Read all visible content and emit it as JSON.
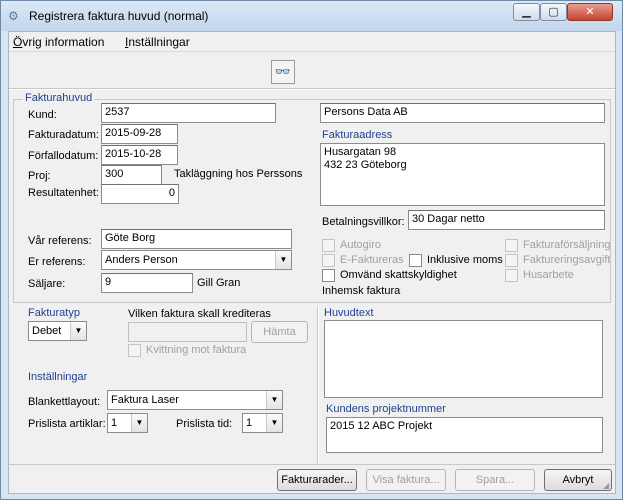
{
  "window": {
    "title": "Registrera faktura huvud (normal)"
  },
  "menu": {
    "item1_first": "Ö",
    "item1_rest": "vrig information",
    "item2_first": "I",
    "item2_rest": "nställningar"
  },
  "header_group": {
    "legend": "Fakturahuvud"
  },
  "fields": {
    "kund_label": "Kund:",
    "kund_value": "2537",
    "fakturadatum_label": "Fakturadatum:",
    "fakturadatum_value": "2015-09-28",
    "forfallodatum_label": "Förfallodatum:",
    "forfallodatum_value": "2015-10-28",
    "proj_label": "Proj:",
    "proj_value": "300",
    "proj_name": "Takläggning hos Perssons",
    "resultatenhet_label": "Resultatenhet:",
    "resultatenhet_value": "0",
    "var_referens_label": "Vår referens:",
    "var_referens_value": "Göte Borg",
    "er_referens_label": "Er referens:",
    "er_referens_value": "Anders Person",
    "saljare_label": "Säljare:",
    "saljare_value": "9",
    "saljare_name": "Gill Gran",
    "customer_name": "Persons Data AB",
    "fakturaadress_label": "Fakturaadress",
    "address_line1": "Husargatan 98",
    "address_line2": "432 23 Göteborg",
    "betalningsvillkor_label": "Betalningsvillkor:",
    "betalningsvillkor_value": "30 Dagar netto"
  },
  "checks": {
    "autogiro": "Autogiro",
    "efaktureras": "E-Faktureras",
    "inklusive_moms": "Inklusive moms",
    "omvand": "Omvänd skattskyldighet",
    "fakturaforsaljning": "Fakturaförsäljning",
    "faktureringsavgift": "Faktureringsavgift",
    "husarbete": "Husarbete",
    "inhemsk": "Inhemsk faktura"
  },
  "fakturatyp": {
    "label": "Fakturatyp",
    "value": "Debet"
  },
  "kreditera": {
    "label": "Vilken faktura skall krediteras",
    "hamta": "Hämta",
    "kvittning": "Kvittning mot faktura"
  },
  "installningar": {
    "legend": "Inställningar",
    "blankett_label": "Blankettlayout:",
    "blankett_value": "Faktura Laser",
    "prislista_artiklar_label": "Prislista artiklar:",
    "prislista_artiklar_value": "1",
    "prislista_tid_label": "Prislista tid:",
    "prislista_tid_value": "1"
  },
  "huvudtext": {
    "label": "Huvudtext",
    "value": ""
  },
  "projektnummer": {
    "label": "Kundens projektnummer",
    "value": "2015 12 ABC Projekt"
  },
  "buttons": {
    "fakturarader": "Fakturarader...",
    "visa": "Visa faktura...",
    "spara": "Spara...",
    "avbryt": "Avbryt"
  },
  "icons": {
    "app": "app-icon",
    "binoculars": "binoculars-icon"
  }
}
